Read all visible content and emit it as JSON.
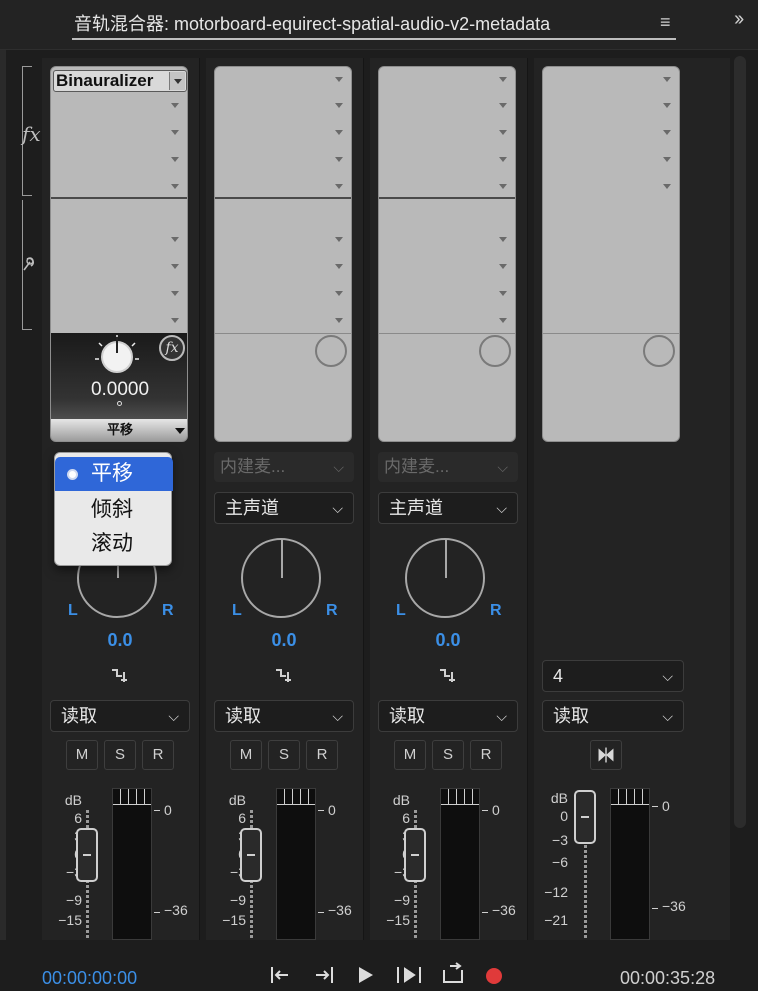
{
  "header": {
    "title": "音轨混合器: motorboard-equirect-spatial-audio-v2-metadata",
    "menu_icon": "hamburger-icon",
    "more_icon": "double-chevron-right-icon"
  },
  "side_labels": {
    "fx": "fx",
    "send_icon": "microphone-icon"
  },
  "channels": [
    {
      "effect_slot": "Binauralizer",
      "param_value": "0.0000",
      "param_name": "平移",
      "input": "",
      "routing": "",
      "pan_l": "L",
      "pan_r": "R",
      "pan_value": "0.0",
      "mode": "读取",
      "m": "M",
      "s": "S",
      "r": "R"
    },
    {
      "input": "内建麦...",
      "routing": "主声道",
      "pan_l": "L",
      "pan_r": "R",
      "pan_value": "0.0",
      "mode": "读取",
      "m": "M",
      "s": "S",
      "r": "R"
    },
    {
      "input": "内建麦...",
      "routing": "主声道",
      "pan_l": "L",
      "pan_r": "R",
      "pan_value": "0.0",
      "mode": "读取",
      "m": "M",
      "s": "S",
      "r": "R"
    },
    {
      "channel_select": "4",
      "mode": "读取"
    }
  ],
  "popup": {
    "options": [
      "平移",
      "倾斜",
      "滚动"
    ],
    "selected": "平移"
  },
  "db_scale": {
    "label": "dB",
    "ticks": [
      "6",
      "3",
      "0",
      "−3",
      "−9",
      "−15"
    ]
  },
  "master_db_scale": {
    "label": "dB",
    "ticks": [
      "0",
      "−3",
      "−6",
      "−12",
      "−21"
    ]
  },
  "meter_scale": [
    "0",
    "−36"
  ],
  "transport": {
    "timecode_current": "00:00:00:00",
    "timecode_total": "00:00:35:28",
    "buttons": [
      "|⇤",
      "⇥|",
      "▶",
      "{▶}",
      "⟲"
    ]
  },
  "colors": {
    "accent": "#3b8fe6",
    "record": "#e03a3a",
    "selection": "#2f67d8"
  }
}
